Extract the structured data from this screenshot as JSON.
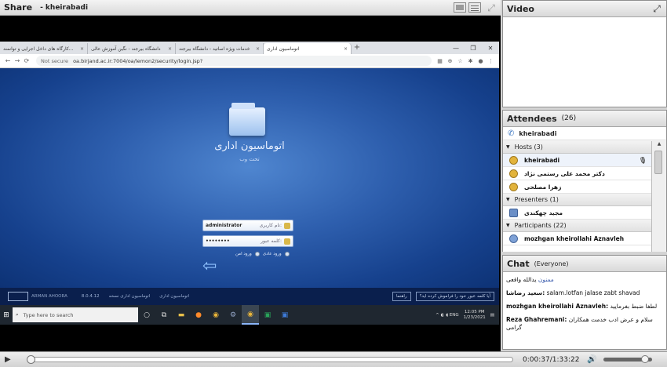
{
  "share": {
    "title": "Share",
    "presenter": "- kheirabadi"
  },
  "browser": {
    "tabs": [
      {
        "label": "کارگاه های داخل اجرایی و توانمند...",
        "close": "×"
      },
      {
        "label": "دانشگاه بیرجند - نگین آموزش عالی",
        "close": "×"
      },
      {
        "label": "خدمات ویژه اساتید - دانشگاه بیرجند",
        "close": "×"
      },
      {
        "label": "اتوماسیون اداری",
        "close": "×"
      }
    ],
    "new_tab": "+",
    "not_secure": "Not secure",
    "url": "oa.birjand.ac.ir:7004/oa/lemon2/security/login.jsp?"
  },
  "login": {
    "app_name": "اتوماسیون اداری",
    "app_sub": "تحت وب",
    "username_label": "نام کاربری:",
    "username_value": "administrator",
    "password_label": "کلمه عبور:",
    "password_value": "••••••••",
    "remember_label": "ورود امن",
    "remember_label2": "ورود عادی"
  },
  "footer": {
    "brand": "ARMAN AHOORA",
    "version": "8.0.4.12",
    "version_label": "اتوماسیون اداری نسخه",
    "copyright": "اتوماسیون اداری",
    "btn_forgot": "آیا کلمه عبور خود را فراموش کرده اید؟",
    "btn_help": "راهنما"
  },
  "taskbar": {
    "search_placeholder": "Type here to search",
    "lang": "ENG",
    "time": "12:05 PM",
    "date": "1/23/2021"
  },
  "video": {
    "title": "Video"
  },
  "attendees": {
    "title": "Attendees",
    "count": "(26)",
    "me": "kheirabadi",
    "groups": [
      {
        "label": "Hosts (3)",
        "users": [
          "kheirabadi",
          "دکتر محمد علی رستمی نژاد",
          "زهرا مصلحی"
        ]
      },
      {
        "label": "Presenters (1)",
        "users": [
          "مجید چهکندی"
        ]
      },
      {
        "label": "Participants (22)",
        "users": [
          "mozhgan kheirollahi Aznavleh"
        ]
      }
    ]
  },
  "chat": {
    "title": "Chat",
    "audience": "(Everyone)",
    "messages": [
      {
        "name": "ممنون",
        "text": " یدالله واقعی"
      },
      {
        "name": "سعید رضاشا:",
        "text": " salam.lotfan jalase zabt shavad"
      },
      {
        "name": "mozhgan kheirollahi Aznavleh:",
        "text": " لطفا ضبط بفرمایید"
      },
      {
        "name": "Reza Ghahremani:",
        "text": " سلام و عرض ادب خدمت همکاران گرامی"
      }
    ]
  },
  "playback": {
    "time": "0:00:37/1:33:22",
    "progress": 0.0066,
    "volume": 0.85
  }
}
